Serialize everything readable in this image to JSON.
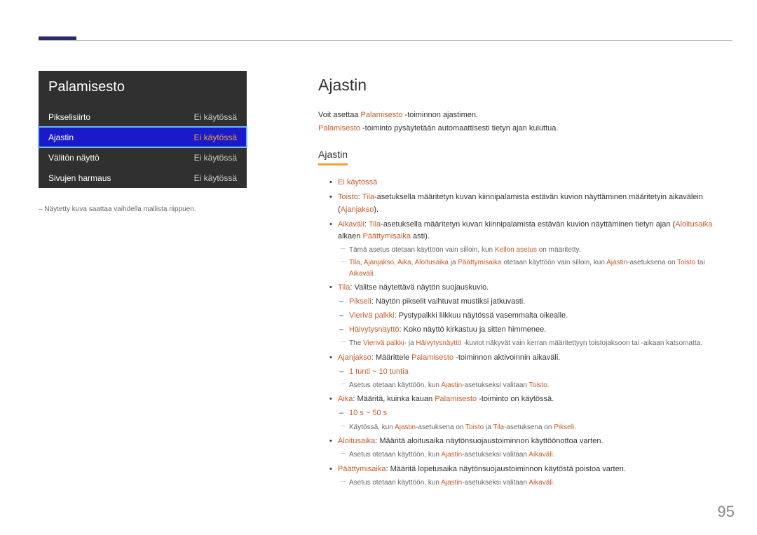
{
  "panel": {
    "title": "Palamisesto",
    "rows": [
      {
        "label": "Pikselisiirto",
        "value": "Ei käytössä",
        "selected": false
      },
      {
        "label": "Ajastin",
        "value": "Ei käytössä",
        "selected": true
      },
      {
        "label": "Välitön näyttö",
        "value": "Ei käytössä",
        "selected": false
      },
      {
        "label": "Sivujen harmaus",
        "value": "Ei käytössä",
        "selected": false
      }
    ]
  },
  "left_note": "Näytetty kuva saattaa vaihdella mallista riippuen.",
  "main": {
    "title": "Ajastin",
    "intro1_a": "Voit asettaa ",
    "intro1_b": "Palamisesto",
    "intro1_c": " -toiminnon ajastimen.",
    "intro2_a": "Palamisesto",
    "intro2_b": " -toiminto pysäytetään automaattisesti tietyn ajan kuluttua.",
    "subheading": "Ajastin",
    "li_off": "Ei käytössä",
    "toisto": {
      "a": "Toisto",
      "b": ": ",
      "c": "Tila",
      "d": "-asetuksella määritetyn kuvan kiinnipalamista estävän kuvion näyttäminen määritetyin aikavälein (",
      "e": "Ajanjakso",
      "f": ")."
    },
    "aikavali": {
      "a": "Aikaväli",
      "b": ": ",
      "c": "Tila",
      "d": "-asetuksella määritetyn kuvan kiinnipalamista estävän kuvion näyttäminen tietyn ajan (",
      "e": "Aloitusaika",
      "f": " alkaen ",
      "g": "Päättymisaika",
      "h": " asti)."
    },
    "note1_a": "Tämä asetus otetaan käyttöön vain silloin, kun ",
    "note1_b": "Kellon asetus",
    "note1_c": " on määritetty.",
    "note2_a": "Tila",
    "note2_b": ", ",
    "note2_c": "Ajanjakso",
    "note2_d": ", ",
    "note2_e": "Aika",
    "note2_f": ", ",
    "note2_g": "Aloitusaika",
    "note2_h": " ja ",
    "note2_i": "Päättymisaika",
    "note2_j": " otetaan käyttöön vain silloin, kun ",
    "note2_k": "Ajastin",
    "note2_l": "-asetuksena on ",
    "note2_m": "Toisto",
    "note2_n": " tai ",
    "note2_o": "Aikaväli",
    "note2_p": ".",
    "tila_a": "Tila",
    "tila_b": ": Valitse näytettävä näytön suojauskuvio.",
    "pikseli_a": "Pikseli",
    "pikseli_b": ": Näytön pikselit vaihtuvat mustiksi jatkuvasti.",
    "vieriva_a": "Vierivä palkki",
    "vieriva_b": ": Pystypalkki liikkuu näytössä vasemmalta oikealle.",
    "haivy_a": "Häivytysnäyttö",
    "haivy_b": ": Koko näyttö kirkastuu ja sitten himmenee.",
    "note3_a": "The ",
    "note3_b": "Vierivä palkki",
    "note3_c": "- ja ",
    "note3_d": "Häivytysnäyttö",
    "note3_e": " -kuviot näkyvät vain kerran määritettyyn toistojaksoon tai -aikaan katsomatta.",
    "ajanjakso_a": "Ajanjakso",
    "ajanjakso_b": ": Määrittele ",
    "ajanjakso_c": "Palamisesto",
    "ajanjakso_d": " -toiminnon aktivoinnin aikaväli.",
    "range1": "1 tunti ~ 10 tuntia",
    "note4_a": "Asetus otetaan käyttöön, kun ",
    "note4_b": "Ajastin",
    "note4_c": "-asetukseksi valitaan ",
    "note4_d": "Toisto",
    "note4_e": ".",
    "aika_a": "Aika",
    "aika_b": ": Määritä, kuinka kauan ",
    "aika_c": "Palamisesto",
    "aika_d": " -toiminto on käytössä.",
    "range2": "10 s ~ 50 s",
    "note5_a": "Käytössä, kun ",
    "note5_b": "Ajastin",
    "note5_c": "-asetuksena on ",
    "note5_d": "Toisto",
    "note5_e": " ja ",
    "note5_f": "Tila",
    "note5_g": "-asetuksena on ",
    "note5_h": "Pikseli",
    "note5_i": ".",
    "aloitus_a": "Aloitusaika",
    "aloitus_b": ": Määritä aloitusaika näytönsuojaustoiminnon käyttöönottoa varten.",
    "note6_a": "Asetus otetaan käyttöön, kun ",
    "note6_b": "Ajastin",
    "note6_c": "-asetukseksi valitaan ",
    "note6_d": "Aikaväli",
    "note6_e": ".",
    "paatt_a": "Päättymisaika",
    "paatt_b": ": Määritä lopetusaika näytönsuojaustoiminnon käytöstä poistoa varten.",
    "note7_a": "Asetus otetaan käyttöön, kun ",
    "note7_b": "Ajastin",
    "note7_c": "-asetukseksi valitaan ",
    "note7_d": "Aikaväli",
    "note7_e": "."
  },
  "page_number": "95"
}
